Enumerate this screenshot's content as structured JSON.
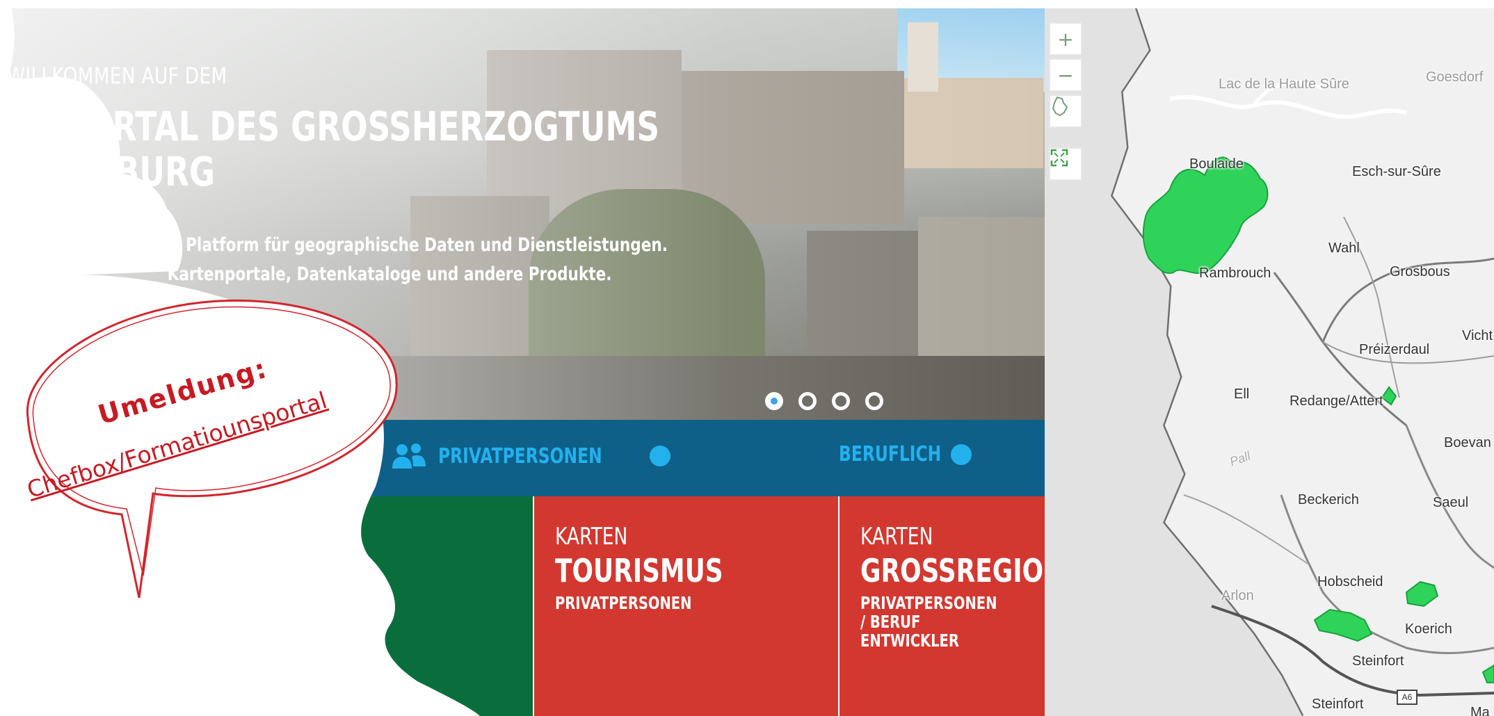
{
  "hero": {
    "kicker": "WILLKOMMEN AUF DEM",
    "title_line1": "PORTAL DES GROSSHERZOGTUMS",
    "title_line2": "EMBURG",
    "desc_line1": "tionale Platform für geographische Daten und Dienstleistungen.",
    "desc_line2": "Kartenportale, Datenkataloge und andere Produkte.",
    "carousel_count": 4,
    "carousel_active": 1
  },
  "nav": {
    "items": [
      {
        "label": "PRIVATPERSONEN"
      },
      {
        "label": "BERUFLICH"
      }
    ]
  },
  "tiles": [
    {
      "kicker": "KARTEN",
      "title": "TOURISMUS",
      "sub": "PRIVATPERSONEN"
    },
    {
      "kicker": "KARTEN",
      "title": "GROSSREGION P",
      "sub_line1": "PRIVATPERSONEN / BERUF",
      "sub_line2": "ENTWICKLER"
    }
  ],
  "map": {
    "controls": {
      "zoom_in": "+",
      "zoom_out": "−"
    },
    "places": [
      "Lac de la Haute Sûre",
      "Goesdorf",
      "Boulaide",
      "Esch-sur-Sûre",
      "Wahl",
      "Rambrouch",
      "Grosbous",
      "Préizerdaul",
      "Vicht",
      "Ell",
      "Redange/Attert",
      "Boevan",
      "Pall",
      "Beckerich",
      "Saeul",
      "Hobscheid",
      "Arlon",
      "Koerich",
      "Steinfort",
      "Steinfort",
      "Ma"
    ],
    "motorway": "A6"
  },
  "bubble": {
    "title": "Umeldung:",
    "link": "Chefbox/Formatiounsportal"
  },
  "colors": {
    "nav_bg": "#0e6088",
    "nav_accent": "#23b1ee",
    "tile_red": "#d23830",
    "tile_green": "#0a6e3c",
    "bubble_red": "#c71a22",
    "map_green": "#2fd35a"
  }
}
